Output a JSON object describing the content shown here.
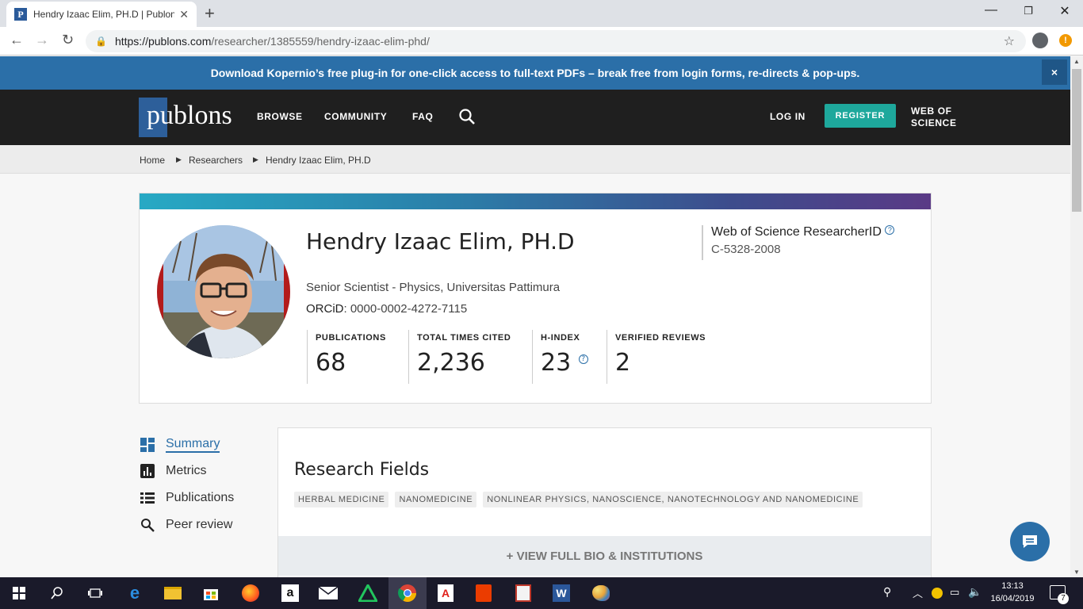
{
  "browser": {
    "tab_title": "Hendry Izaac Elim, PH.D | Publons",
    "tab_favicon": "P",
    "url_host": "https://publons.com",
    "url_path": "/researcher/1385559/hendry-izaac-elim-phd/"
  },
  "banner": {
    "text": "Download Kopernio’s free plug-in for one-click access to full-text PDFs – break free from login forms, re-directs & pop-ups.",
    "close": "×"
  },
  "header": {
    "logo_text": "publons",
    "nav": [
      "BROWSE",
      "COMMUNITY",
      "FAQ"
    ],
    "login": "LOG IN",
    "register": "REGISTER",
    "wos": "WEB OF SCIENCE"
  },
  "breadcrumb": [
    "Home",
    "Researchers",
    "Hendry Izaac Elim, PH.D"
  ],
  "profile": {
    "name": "Hendry Izaac Elim, PH.D",
    "role": "Senior Scientist - Physics, Universitas Pattimura",
    "orcid_label": "ORCiD",
    "orcid_value": ": 0000-0002-4272-7115",
    "researcher_id_label": "Web of Science ResearcherID",
    "researcher_id_value": "C-5328-2008",
    "stats": [
      {
        "label": "PUBLICATIONS",
        "value": "68"
      },
      {
        "label": "TOTAL TIMES CITED",
        "value": "2,236"
      },
      {
        "label": "H-INDEX",
        "value": "23"
      },
      {
        "label": "VERIFIED REVIEWS",
        "value": "2"
      }
    ]
  },
  "menu": [
    "Summary",
    "Metrics",
    "Publications",
    "Peer review"
  ],
  "research": {
    "title": "Research Fields",
    "tags": [
      "HERBAL MEDICINE",
      "NANOMEDICINE",
      "NONLINEAR PHYSICS, NANOSCIENCE, NANOTECHNOLOGY AND NANOMEDICINE"
    ],
    "view_full": "+ VIEW FULL BIO & INSTITUTIONS"
  },
  "taskbar": {
    "time": "13:13",
    "date": "16/04/2019",
    "notifications": "7"
  },
  "colors": {
    "brand": "#2b6fa8",
    "register": "#1ea89c",
    "header_bg": "#1f1f1f"
  }
}
